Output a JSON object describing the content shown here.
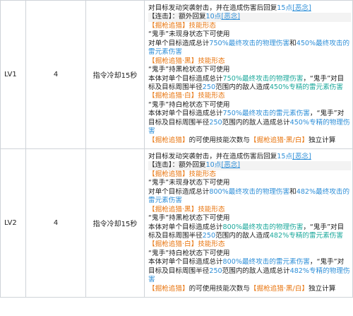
{
  "rows": [
    {
      "level": "LV1",
      "count": "4",
      "cooldown": "指令冷却15秒",
      "lines": [
        {
          "segments": [
            {
              "text": "对目标发动突袭射击，并在造成伤害后回复"
            },
            {
              "text": "15点",
              "color": "b"
            },
            {
              "text": "[恶念]",
              "color": "b",
              "underline": true
            }
          ]
        },
        {
          "highlight": true,
          "segments": [
            {
              "text": "【连击】：额外回复"
            },
            {
              "text": "10点",
              "color": "b"
            },
            {
              "text": "[恶念]",
              "color": "b",
              "underline": true
            }
          ]
        },
        {
          "segments": [
            {
              "text": "【掘枪追猎】技能形态",
              "color": "o"
            }
          ]
        },
        {
          "segments": [
            {
              "text": "“鬼手”未现身状态下可使用"
            }
          ]
        },
        {
          "segments": [
            {
              "text": "对单个目标造成总计"
            },
            {
              "text": "750%最终攻击的物理伤害",
              "color": "b"
            },
            {
              "text": "和"
            },
            {
              "text": "450%最终攻击的",
              "color": "b"
            }
          ]
        },
        {
          "segments": [
            {
              "text": "雷元素伤害",
              "color": "b"
            }
          ]
        },
        {
          "segments": [
            {
              "text": "【掘枪追猎·黑】技能形态",
              "color": "o"
            }
          ]
        },
        {
          "segments": [
            {
              "text": "“鬼手”持黑枪状态下可使用"
            }
          ]
        },
        {
          "segments": [
            {
              "text": "本体对单个目标造成总计"
            },
            {
              "text": "750%最终攻击的物理伤害",
              "color": "t"
            },
            {
              "text": "，“鬼手”对目"
            }
          ]
        },
        {
          "segments": [
            {
              "text": "标及目标周围半径"
            },
            {
              "text": "250",
              "color": "b"
            },
            {
              "text": "范围内的敌人造成"
            },
            {
              "text": "450%专精的雷元素伤害",
              "color": "t"
            }
          ]
        },
        {
          "segments": [
            {
              "text": "【掘枪追猎·白】技能形态",
              "color": "o"
            }
          ]
        },
        {
          "segments": [
            {
              "text": "“鬼手”持白枪状态下可使用"
            }
          ]
        },
        {
          "segments": [
            {
              "text": "本体对单个目标造成总计"
            },
            {
              "text": "750%最终攻击的雷元素伤害",
              "color": "b"
            },
            {
              "text": "，“鬼手”对"
            }
          ]
        },
        {
          "segments": [
            {
              "text": "目标及目标周围半径"
            },
            {
              "text": "250",
              "color": "b"
            },
            {
              "text": "范围内的敌人造成总计"
            },
            {
              "text": "450%专精的物理伤",
              "color": "b"
            }
          ]
        },
        {
          "segments": [
            {
              "text": "害",
              "color": "b"
            }
          ]
        },
        {
          "segments": [
            {
              "text": "【掘枪追猎】",
              "color": "o"
            },
            {
              "text": "的可使用技能次数与"
            },
            {
              "text": "【掘枪追猎·黑/白】",
              "color": "o"
            },
            {
              "text": "独立计算"
            }
          ]
        }
      ]
    },
    {
      "level": "LV2",
      "count": "4",
      "cooldown": "指令冷却15秒",
      "lines": [
        {
          "segments": [
            {
              "text": "对目标发动突袭射击，并在造成伤害后回复"
            },
            {
              "text": "15点",
              "color": "b"
            },
            {
              "text": "[恶念]",
              "color": "b",
              "underline": true
            }
          ]
        },
        {
          "highlight": true,
          "segments": [
            {
              "text": "【连击】：额外回复"
            },
            {
              "text": "10点",
              "color": "b"
            },
            {
              "text": "[恶念]",
              "color": "b",
              "underline": true
            }
          ]
        },
        {
          "segments": [
            {
              "text": "【掘枪追猎】技能形态",
              "color": "o"
            }
          ]
        },
        {
          "segments": [
            {
              "text": "“鬼手”未现身状态下可使用"
            }
          ]
        },
        {
          "segments": [
            {
              "text": "对单个目标造成总计"
            },
            {
              "text": "800%最终攻击的物理伤害",
              "color": "b"
            },
            {
              "text": "和"
            },
            {
              "text": "482%最终攻击的",
              "color": "b"
            }
          ]
        },
        {
          "segments": [
            {
              "text": "雷元素伤害",
              "color": "b"
            }
          ]
        },
        {
          "segments": [
            {
              "text": "【掘枪追猎·黑】技能形态",
              "color": "o"
            }
          ]
        },
        {
          "segments": [
            {
              "text": "“鬼手”持黑枪状态下可使用"
            }
          ]
        },
        {
          "segments": [
            {
              "text": "本体对单个目标造成总计"
            },
            {
              "text": "800%最终攻击的物理伤害",
              "color": "t"
            },
            {
              "text": "，“鬼手”对目"
            }
          ]
        },
        {
          "segments": [
            {
              "text": "标及目标周围半径"
            },
            {
              "text": "250",
              "color": "b"
            },
            {
              "text": "范围内的敌人造成"
            },
            {
              "text": "482%专精的雷元素伤害",
              "color": "t"
            }
          ]
        },
        {
          "segments": [
            {
              "text": "【掘枪追猎·白】技能形态",
              "color": "o"
            }
          ]
        },
        {
          "segments": [
            {
              "text": "“鬼手”持白枪状态下可使用"
            }
          ]
        },
        {
          "segments": [
            {
              "text": "本体对单个目标造成总计"
            },
            {
              "text": "800%最终攻击的雷元素伤害",
              "color": "b"
            },
            {
              "text": "，“鬼手”对"
            }
          ]
        },
        {
          "segments": [
            {
              "text": "目标及目标周围半径"
            },
            {
              "text": "250",
              "color": "b"
            },
            {
              "text": "范围内的敌人造成总计"
            },
            {
              "text": "482%专精的物理伤",
              "color": "b"
            }
          ]
        },
        {
          "segments": [
            {
              "text": "害",
              "color": "b"
            }
          ]
        },
        {
          "segments": [
            {
              "text": "【掘枪追猎】",
              "color": "o"
            },
            {
              "text": "的可使用技能次数与"
            },
            {
              "text": "【掘枪追猎·黑/白】",
              "color": "o"
            },
            {
              "text": "独立计算"
            }
          ]
        }
      ]
    }
  ],
  "colors": {
    "orange": "#e8750f",
    "blue": "#2f8fd8",
    "teal": "#1ba89b",
    "highlight": "#f3f3f3",
    "border": "#cfd3d8"
  }
}
